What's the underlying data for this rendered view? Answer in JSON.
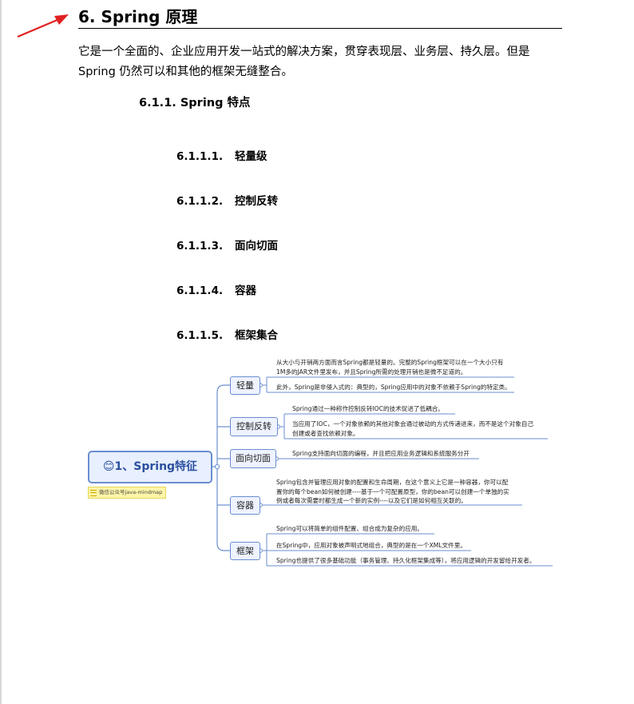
{
  "section": {
    "title": "6. Spring 原理"
  },
  "intro": "它是一个全面的、企业应用开发一站式的解决方案，贯穿表现层、业务层、持久层。但是 Spring 仍然可以和其他的框架无缝整合。",
  "subsection": {
    "title": "6.1.1.  Spring 特点"
  },
  "subsubsections": [
    {
      "num": "6.1.1.1.",
      "title": "轻量级"
    },
    {
      "num": "6.1.1.2.",
      "title": "控制反转"
    },
    {
      "num": "6.1.1.3.",
      "title": "面向切面"
    },
    {
      "num": "6.1.1.4.",
      "title": "容器"
    },
    {
      "num": "6.1.1.5.",
      "title": "框架集合"
    }
  ],
  "mindmap": {
    "root": "😊1、Spring特征",
    "tag": "微信公众号java-mindmap",
    "branches": [
      {
        "label": "轻量",
        "leaves": [
          [
            "从大小与开销两方面而言Spring都是轻量的。完整的Spring框架可以在一个大小只有",
            "1M多的JAR文件里发布，并且Spring所需的处理开销也是微不足道的。"
          ],
          [
            "此外，Spring是非侵入式的：典型的，Spring应用中的对象不依赖于Spring的特定类。"
          ]
        ]
      },
      {
        "label": "控制反转",
        "leaves": [
          [
            "Spring通过一种称作控制反转IOC的技术促进了低耦合。"
          ],
          [
            "当应用了IOC，一个对象依赖的其他对象会通过被动的方式传递进来，而不是这个对象自己",
            "创建或者查找依赖对象。"
          ]
        ]
      },
      {
        "label": "面向切面",
        "leaves": [
          [
            "Spring支持面向切面的编程，并且把应用业务逻辑和系统服务分开"
          ]
        ]
      },
      {
        "label": "容器",
        "leaves": [
          [
            "Spring包含并管理应用对象的配置和生命周期，在这个意义上它是一种容器，你可以配",
            "置你的每个bean如何被创建----基于一个可配置原型，你的bean可以创建一个单独的实",
            "例或者每次需要时都生成一个新的实例----以及它们是如何相互关联的。"
          ]
        ]
      },
      {
        "label": "框架",
        "leaves": [
          [
            "Spring可以将简单的组件配置、组合成为复杂的应用。"
          ],
          [
            "在Spring中，应用对象被声明式地组合，典型的是在一个XML文件里。"
          ],
          [
            "Spring也提供了很多基础功能（事务管理、持久化框架集成等），将应用逻辑的开发留给开发者。"
          ]
        ]
      }
    ]
  }
}
